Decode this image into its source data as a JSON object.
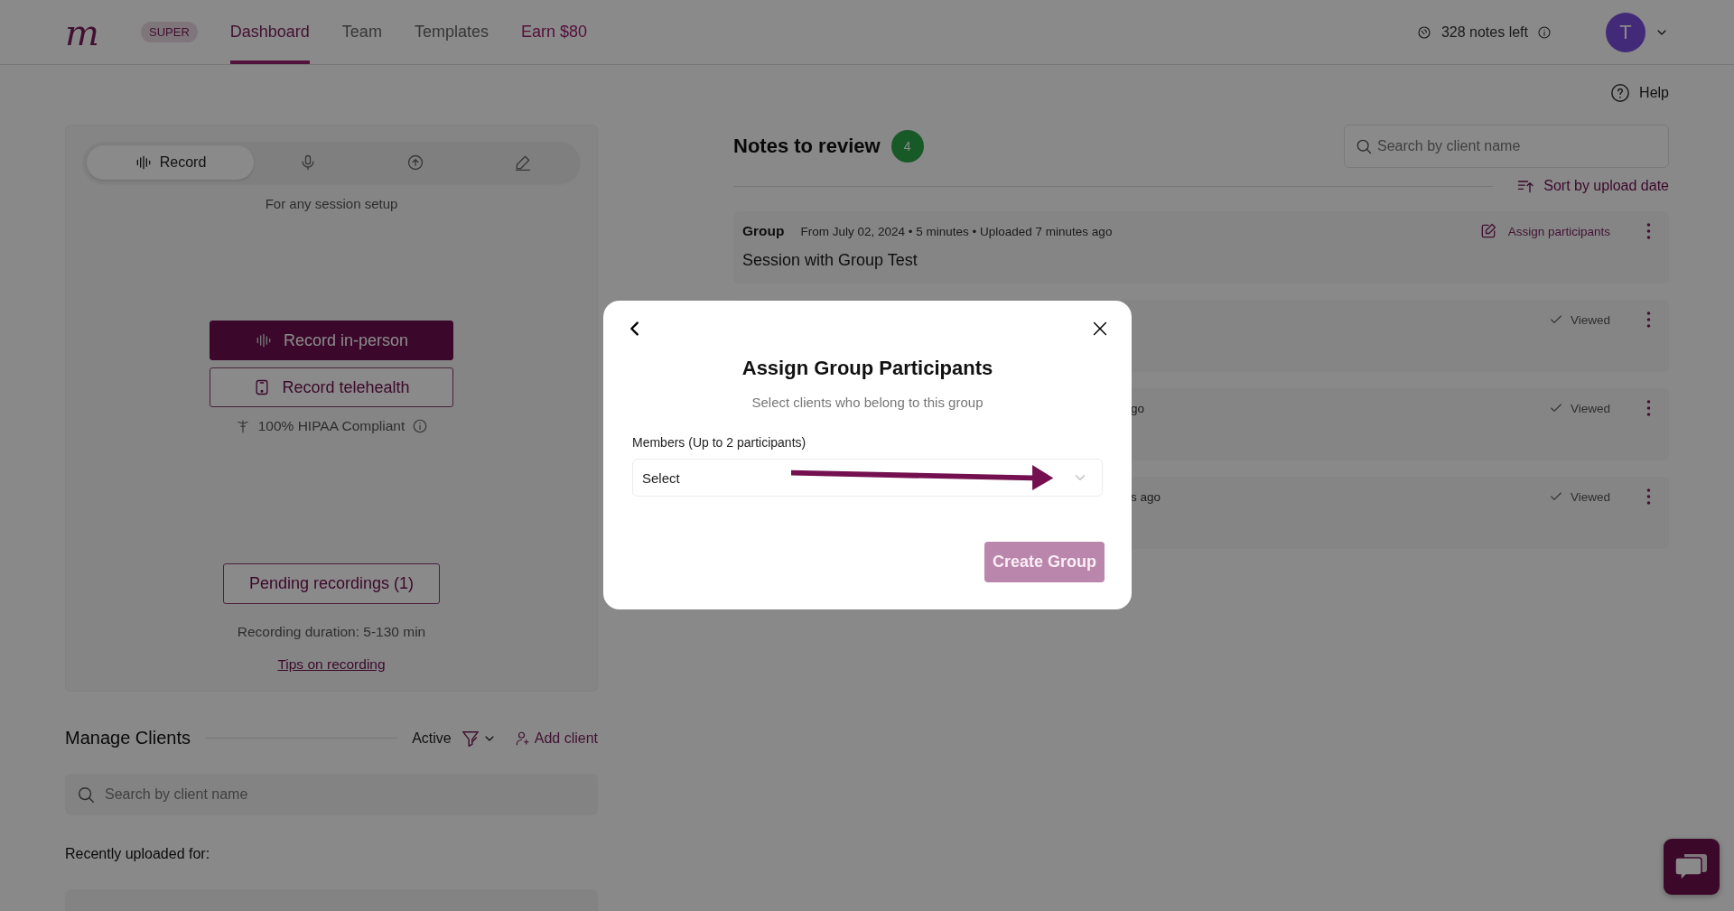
{
  "header": {
    "logo": "m",
    "badge": "SUPER",
    "tabs": [
      {
        "label": "Dashboard",
        "selected": true,
        "kind": "nav"
      },
      {
        "label": "Team",
        "selected": false,
        "kind": "nav"
      },
      {
        "label": "Templates",
        "selected": false,
        "kind": "nav"
      },
      {
        "label": "Earn $80",
        "selected": false,
        "kind": "promo"
      }
    ],
    "notes_left": "328 notes left",
    "avatar": "T"
  },
  "help": "Help",
  "recorder": {
    "modes": [
      {
        "kind": "waveform",
        "label": "Record",
        "selected": true
      },
      {
        "kind": "microphone",
        "selected": false
      },
      {
        "kind": "upload",
        "selected": false
      },
      {
        "kind": "pen",
        "selected": false
      }
    ],
    "caption": "For any session setup",
    "buttons": [
      {
        "kind": "primary",
        "label": "Record in-person"
      },
      {
        "kind": "outline",
        "label": "Record telehealth"
      }
    ],
    "compliance": "100% HIPAA Compliant",
    "pending": "Pending recordings (1)",
    "duration": "Recording duration: 5-130 min",
    "tips_link": "Tips on recording"
  },
  "clients": {
    "title": "Manage Clients",
    "filter": "Active",
    "add": "Add client",
    "search": {
      "placeholder": "Search by client name"
    },
    "recent_label": "Recently uploaded for:"
  },
  "notes": {
    "title": "Notes to review",
    "count": "4",
    "search": {
      "placeholder": "Search by client name"
    },
    "sort": "Sort by upload date",
    "rows": [
      {
        "type": "Group",
        "meta": "From July 02, 2024 • 5 minutes • Uploaded 7 minutes ago",
        "title": "Session with Group Test",
        "action": "Assign participants"
      },
      {
        "status": "Viewed"
      },
      {
        "meta": "go",
        "status": "Viewed"
      },
      {
        "meta": "s ago",
        "status": "Viewed"
      }
    ]
  },
  "modal": {
    "title": "Assign Group Participants",
    "subtitle": "Select clients who belong to this group",
    "field_label": "Members (Up to 2 participants)",
    "select": {
      "placeholder": "Select"
    },
    "submit": {
      "label": "Create Group",
      "disabled": true
    }
  }
}
